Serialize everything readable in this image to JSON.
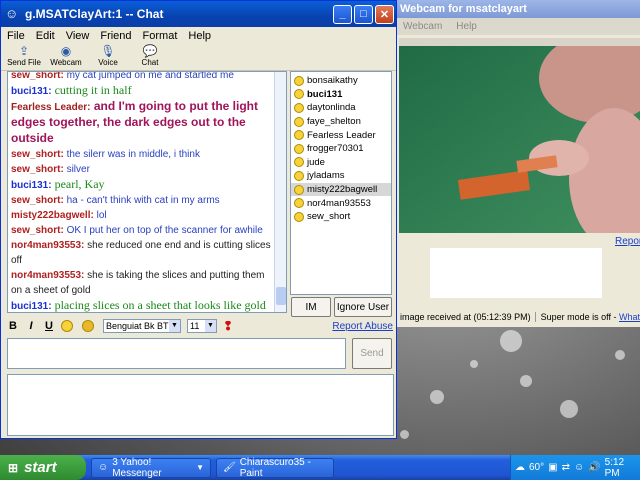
{
  "chat": {
    "title": "g.MSATClayArt:1 -- Chat",
    "menu": [
      "File",
      "Edit",
      "View",
      "Friend",
      "Format",
      "Help"
    ],
    "tools": [
      {
        "label": "Send File",
        "icon": "send-file-icon"
      },
      {
        "label": "Webcam",
        "icon": "webcam-icon"
      },
      {
        "label": "Voice",
        "icon": "microphone-icon"
      },
      {
        "label": "Chat",
        "icon": "chat-bubble-icon"
      }
    ],
    "messages": [
      {
        "nick": "sew_short:",
        "text": " my cat jumped on me and startled me",
        "nick_color": "#b02020",
        "text_color": "#2a40c0",
        "size": "10px"
      },
      {
        "nick": "buci131:",
        "text": " cutting it in half",
        "nick_color": "#1a2fd0",
        "text_color": "#1a8a1a",
        "size": "12px"
      },
      {
        "nick": "Fearless Leader:",
        "text": " and I'm going to put the light edges together, the dark edges out to the outside",
        "nick_color": "#a02020",
        "text_color": "#a0145a",
        "size": "12px"
      },
      {
        "nick": "sew_short:",
        "text": " the silerr was in middle, i think",
        "nick_color": "#b02020",
        "text_color": "#2a40c0",
        "size": "10px"
      },
      {
        "nick": "sew_short:",
        "text": " silver",
        "nick_color": "#b02020",
        "text_color": "#2a40c0",
        "size": "10px"
      },
      {
        "nick": "buci131:",
        "text": " pearl, Kay",
        "nick_color": "#1a2fd0",
        "text_color": "#1a8a1a",
        "size": "12px"
      },
      {
        "nick": "sew_short:",
        "text": " ha - can't think with cat in my arms",
        "nick_color": "#b02020",
        "text_color": "#2a40c0",
        "size": "10px"
      },
      {
        "nick": "misty222bagwell:",
        "text": " lol",
        "nick_color": "#b02020",
        "text_color": "#2a40c0",
        "size": "10px"
      },
      {
        "nick": "sew_short:",
        "text": " OK I put her on top of the scanner for awhile",
        "nick_color": "#b02020",
        "text_color": "#2a40c0",
        "size": "10px"
      },
      {
        "nick": "nor4man93553:",
        "text": " she reduced one end and is cutting slices off",
        "nick_color": "#b02020",
        "text_color": "#222222",
        "size": "10px"
      },
      {
        "nick": "nor4man93553:",
        "text": " she is taking the slices and putting them on a sheet of gold",
        "nick_color": "#b02020",
        "text_color": "#222222",
        "size": "10px"
      },
      {
        "nick": "buci131:",
        "text": " placing slices on a sheet that looks like gold",
        "nick_color": "#1a2fd0",
        "text_color": "#1a8a1a",
        "size": "12px"
      }
    ],
    "buddies": [
      {
        "name": "bonsaikathy",
        "bold": false,
        "selected": false
      },
      {
        "name": "buci131",
        "bold": true,
        "selected": false
      },
      {
        "name": "daytonlinda",
        "bold": false,
        "selected": false
      },
      {
        "name": "faye_shelton",
        "bold": false,
        "selected": false
      },
      {
        "name": "Fearless Leader",
        "bold": false,
        "selected": false
      },
      {
        "name": "frogger70301",
        "bold": false,
        "selected": false
      },
      {
        "name": "jude",
        "bold": false,
        "selected": false
      },
      {
        "name": "jyladams",
        "bold": false,
        "selected": false
      },
      {
        "name": "misty222bagwell",
        "bold": false,
        "selected": true
      },
      {
        "name": "nor4man93553",
        "bold": false,
        "selected": false
      },
      {
        "name": "sew_short",
        "bold": false,
        "selected": false
      }
    ],
    "im_button": "IM",
    "ignore_button": "Ignore User",
    "font_name": "Benguiat Bk BT",
    "font_size": "11",
    "report_abuse": "Report Abuse",
    "send_button": "Send"
  },
  "webcam": {
    "title": "Webcam for msatclayart",
    "menu": [
      "Webcam",
      "Help"
    ],
    "report": "Report",
    "status_left": "image received at (05:12:39 PM)",
    "status_right": "Super mode is off - ",
    "status_link": "What"
  },
  "taskbar": {
    "start": "start",
    "tasks": [
      {
        "label": "3 Yahoo! Messenger",
        "icon": "messenger-icon"
      },
      {
        "label": "Chiarascuro35 - Paint",
        "icon": "paint-icon"
      }
    ],
    "temp": "60°",
    "clock": "5:12 PM"
  }
}
